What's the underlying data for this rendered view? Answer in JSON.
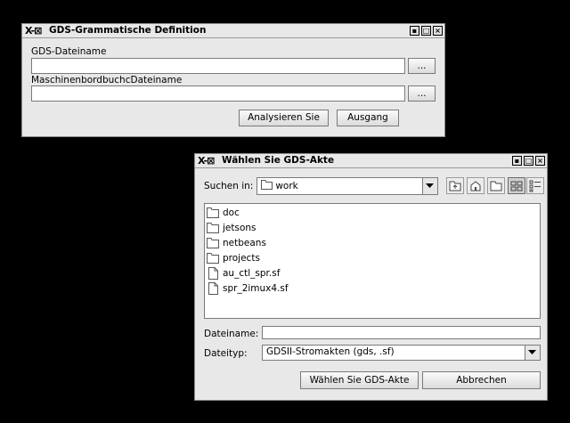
{
  "window1": {
    "title": "GDS-Grammatische Definition",
    "gds_label": "GDS-Dateiname",
    "gds_value": "",
    "browse1_label": "...",
    "machine_label": "MaschinenbordbuchcDateiname",
    "machine_value": "",
    "browse2_label": "...",
    "analyze_label": "Analysieren Sie",
    "exit_label": "Ausgang"
  },
  "window2": {
    "title": "Wählen Sie GDS-Akte",
    "look_in_label": "Suchen in:",
    "look_in_value": "work",
    "items": [
      {
        "name": "doc",
        "type": "folder"
      },
      {
        "name": "jetsons",
        "type": "folder"
      },
      {
        "name": "netbeans",
        "type": "folder"
      },
      {
        "name": "projects",
        "type": "folder"
      },
      {
        "name": "au_ctl_spr.sf",
        "type": "file"
      },
      {
        "name": "spr_2imux4.sf",
        "type": "file"
      }
    ],
    "filename_label": "Dateiname:",
    "filename_value": "",
    "filetype_label": "Dateityp:",
    "filetype_value": "GDSII-Stromakten (gds, .sf)",
    "select_label": "Wählen Sie GDS-Akte",
    "cancel_label": "Abbrechen"
  },
  "titlebar": {
    "logo": "X-⊠",
    "min": "▪",
    "max": "□",
    "close": "×"
  }
}
